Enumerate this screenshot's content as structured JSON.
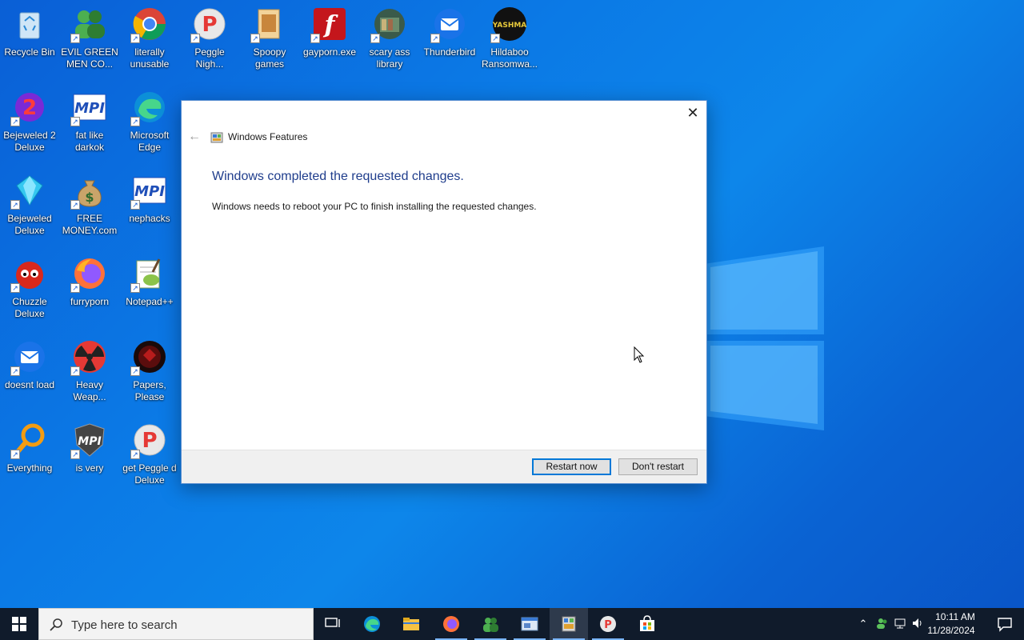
{
  "desktop_icons": [
    {
      "label": "Recycle Bin",
      "icon": "recycle-bin-icon"
    },
    {
      "label": "EVIL GREEN MEN CO...",
      "icon": "green-men-icon"
    },
    {
      "label": "literally unusable",
      "icon": "chrome-icon"
    },
    {
      "label": "Peggle Nigh...",
      "icon": "peggle-icon"
    },
    {
      "label": "Spoopy games",
      "icon": "folder-icon"
    },
    {
      "label": "gayporn.exe",
      "icon": "flash-icon"
    },
    {
      "label": "scary ass library",
      "icon": "library-icon"
    },
    {
      "label": "Thunderbird",
      "icon": "thunderbird-icon"
    },
    {
      "label": "Hildaboo Ransomwa...",
      "icon": "yashma-icon"
    },
    {
      "label": "Bejeweled 2 Deluxe",
      "icon": "bejeweled2-icon"
    },
    {
      "label": "fat like darkok",
      "icon": "mpi-icon"
    },
    {
      "label": "Microsoft Edge",
      "icon": "edge-icon"
    },
    {
      "label": "Bejeweled Deluxe",
      "icon": "gem-icon"
    },
    {
      "label": "FREE MONEY.com",
      "icon": "money-bag-icon"
    },
    {
      "label": "nephacks",
      "icon": "mpi-icon"
    },
    {
      "label": "Chuzzle Deluxe",
      "icon": "chuzzle-icon"
    },
    {
      "label": "furryporn",
      "icon": "firefox-icon"
    },
    {
      "label": "Notepad++",
      "icon": "notepad-plus-icon"
    },
    {
      "label": "doesnt load",
      "icon": "thunderbird-icon"
    },
    {
      "label": "Heavy Weap...",
      "icon": "radiation-icon"
    },
    {
      "label": "Papers, Please",
      "icon": "papers-please-icon"
    },
    {
      "label": "Everything",
      "icon": "magnifier-icon"
    },
    {
      "label": "is very",
      "icon": "mpi-shield-icon"
    },
    {
      "label": "get Peggle d Deluxe",
      "icon": "peggle-icon"
    }
  ],
  "dialog": {
    "app_title": "Windows Features",
    "heading": "Windows completed the requested changes.",
    "message": "Windows needs to reboot your PC to finish installing the requested changes.",
    "restart_label": "Restart now",
    "dont_restart_label": "Don't restart",
    "close_glyph": "✕",
    "back_glyph": "←"
  },
  "taskbar": {
    "search_placeholder": "Type here to search",
    "apps": [
      "task-view-icon",
      "edge-icon",
      "file-explorer-icon",
      "firefox-icon",
      "green-men-icon",
      "app-window-icon",
      "windows-features-icon",
      "peggle-icon",
      "store-icon"
    ],
    "clock_time": "10:11 AM",
    "clock_date": "11/28/2024"
  },
  "colors": {
    "accent": "#0078d7",
    "heading": "#1f3d8c",
    "taskbar": "#101b2b"
  }
}
